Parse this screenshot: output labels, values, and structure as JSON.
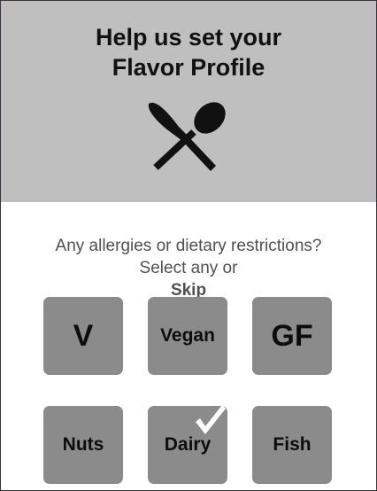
{
  "header": {
    "title_line1": "Help us set your",
    "title_line2": "Flavor Profile",
    "icon": "utensils-icon"
  },
  "question": {
    "line1": "Any allergies or dietary restrictions?",
    "line2_prefix": "Select any or ",
    "skip_label": "Skip"
  },
  "options": [
    {
      "label": "V",
      "selected": false
    },
    {
      "label": "Vegan",
      "selected": false
    },
    {
      "label": "GF",
      "selected": false
    },
    {
      "label": "Nuts",
      "selected": false
    },
    {
      "label": "Dairy",
      "selected": true
    },
    {
      "label": "Fish",
      "selected": false
    }
  ],
  "colors": {
    "header_bg": "#bfbfbf",
    "option_bg": "#8b8b8b",
    "text_dark": "#111111",
    "text_muted": "#505050",
    "check": "#ffffff"
  }
}
